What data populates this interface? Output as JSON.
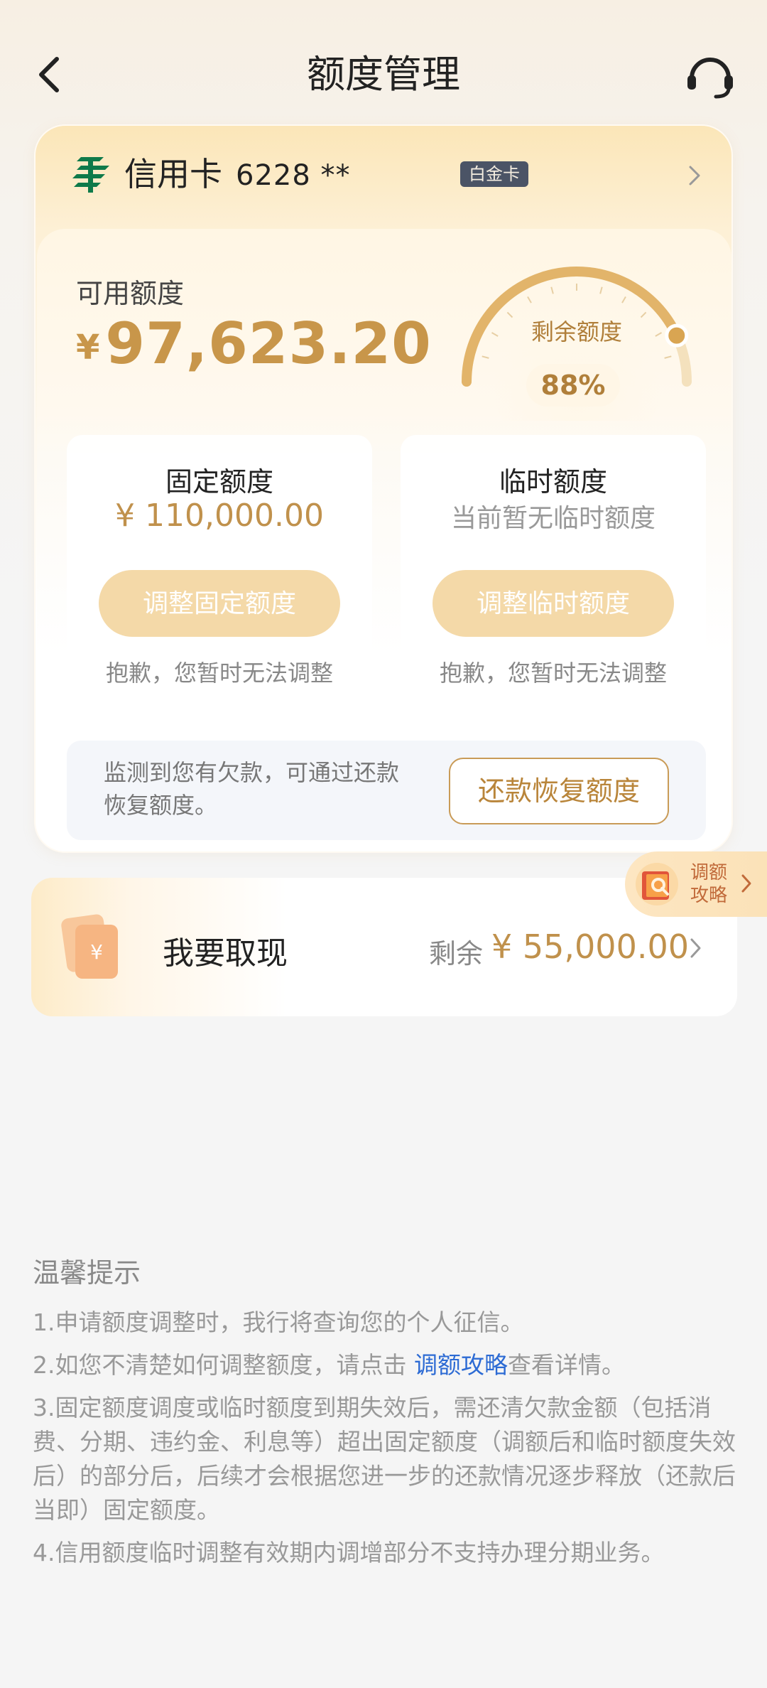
{
  "header": {
    "title": "额度管理"
  },
  "card": {
    "type_label": "信用卡",
    "number": "6228 **",
    "level": "白金卡"
  },
  "available": {
    "label": "可用额度",
    "currency": "¥",
    "amount": "97,623.20",
    "gauge_label": "剩余额度",
    "gauge_percent": "88%",
    "gauge_value": 0.88
  },
  "fixed_limit": {
    "title": "固定额度",
    "value": "¥ 110,000.00",
    "button": "调整固定额度",
    "hint": "抱歉，您暂时无法调整"
  },
  "temp_limit": {
    "title": "临时额度",
    "note": "当前暂无临时额度",
    "button": "调整临时额度",
    "hint": "抱歉，您暂时无法调整"
  },
  "debt": {
    "text": "监测到您有欠款，可通过还款恢复额度。",
    "button": "还款恢复额度"
  },
  "strategy": {
    "label": "调额攻略"
  },
  "cash": {
    "title": "我要取现",
    "remain_label": "剩余",
    "remain_amount": "¥ 55,000.00"
  },
  "tips": {
    "title": "温馨提示",
    "item1": "1.申请额度调整时，我行将查询您的个人征信。",
    "item2_prefix": "2.如您不清楚如何调整额度，请点击 ",
    "item2_link": "调额攻略",
    "item2_suffix": "查看详情。",
    "item3": "3.固定额度调度或临时额度到期失效后，需还清欠款金额（包括消费、分期、违约金、利息等）超出固定额度（调额后和临时额度失效后）的部分后，后续才会根据您进一步的还款情况逐步释放（还款后当即）固定额度。",
    "item4": "4.信用额度临时调整有效期内调增部分不支持办理分期业务。"
  },
  "colors": {
    "gold": "#c8964a",
    "button_disabled": "#f4d9a8",
    "link": "#2d6bd4"
  },
  "icons": [
    "back-arrow-icon",
    "headset-icon",
    "bank-logo-icon",
    "chevron-right-icon",
    "cash-card-icon",
    "strategy-book-icon"
  ]
}
